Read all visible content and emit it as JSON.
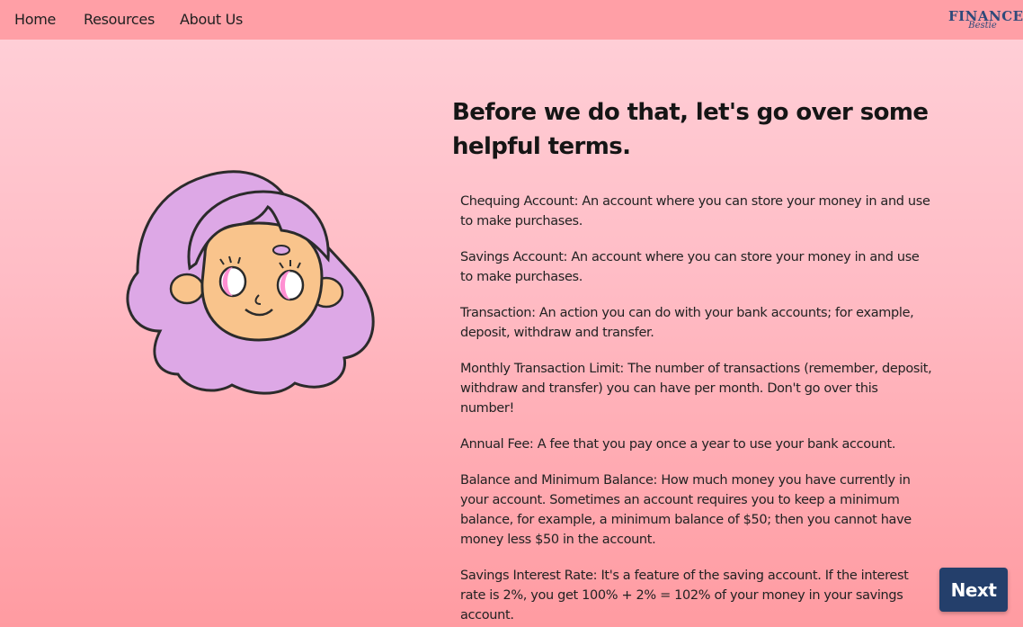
{
  "nav": {
    "home": "Home",
    "resources": "Resources",
    "about": "About Us"
  },
  "logo": {
    "main": "FINANCE",
    "sub": "Bestie"
  },
  "heading": "Before we do that, let's go over some helpful terms.",
  "terms": [
    {
      "name": "Chequing Account:",
      "definition": " An account where you can store your money in and use to make purchases."
    },
    {
      "name": "Savings Account:",
      "definition": " An account where you can store your money in and use to make purchases."
    },
    {
      "name": "Transaction:",
      "definition": " An action you can do with your bank accounts; for example, deposit, withdraw and transfer."
    },
    {
      "name": "Monthly Transaction Limit:",
      "definition": " The number of transactions (remember, deposit, withdraw and transfer) you can have per month. Don't go over this number!"
    },
    {
      "name": "Annual Fee:",
      "definition": " A fee that you pay once a year to use your bank account."
    },
    {
      "name": "Balance and Minimum Balance:",
      "definition": " How much money you have currently in your account. Sometimes an account requires you to keep a minimum balance, for example, a minimum balance of $50; then you cannot have money less $50 in the account."
    },
    {
      "name": "Savings Interest Rate:",
      "definition": " It's a feature of the saving account. If the interest rate is 2%, you get 100% + 2% = 102% of your money in your savings account."
    }
  ],
  "next_button": "Next",
  "colors": {
    "navbar": "#ff9fa6",
    "button": "#243f6b",
    "hair": "#dda8e6",
    "skin": "#f9c48c",
    "logo": "#2f4a7a"
  },
  "illustration": "girl-with-purple-hair"
}
